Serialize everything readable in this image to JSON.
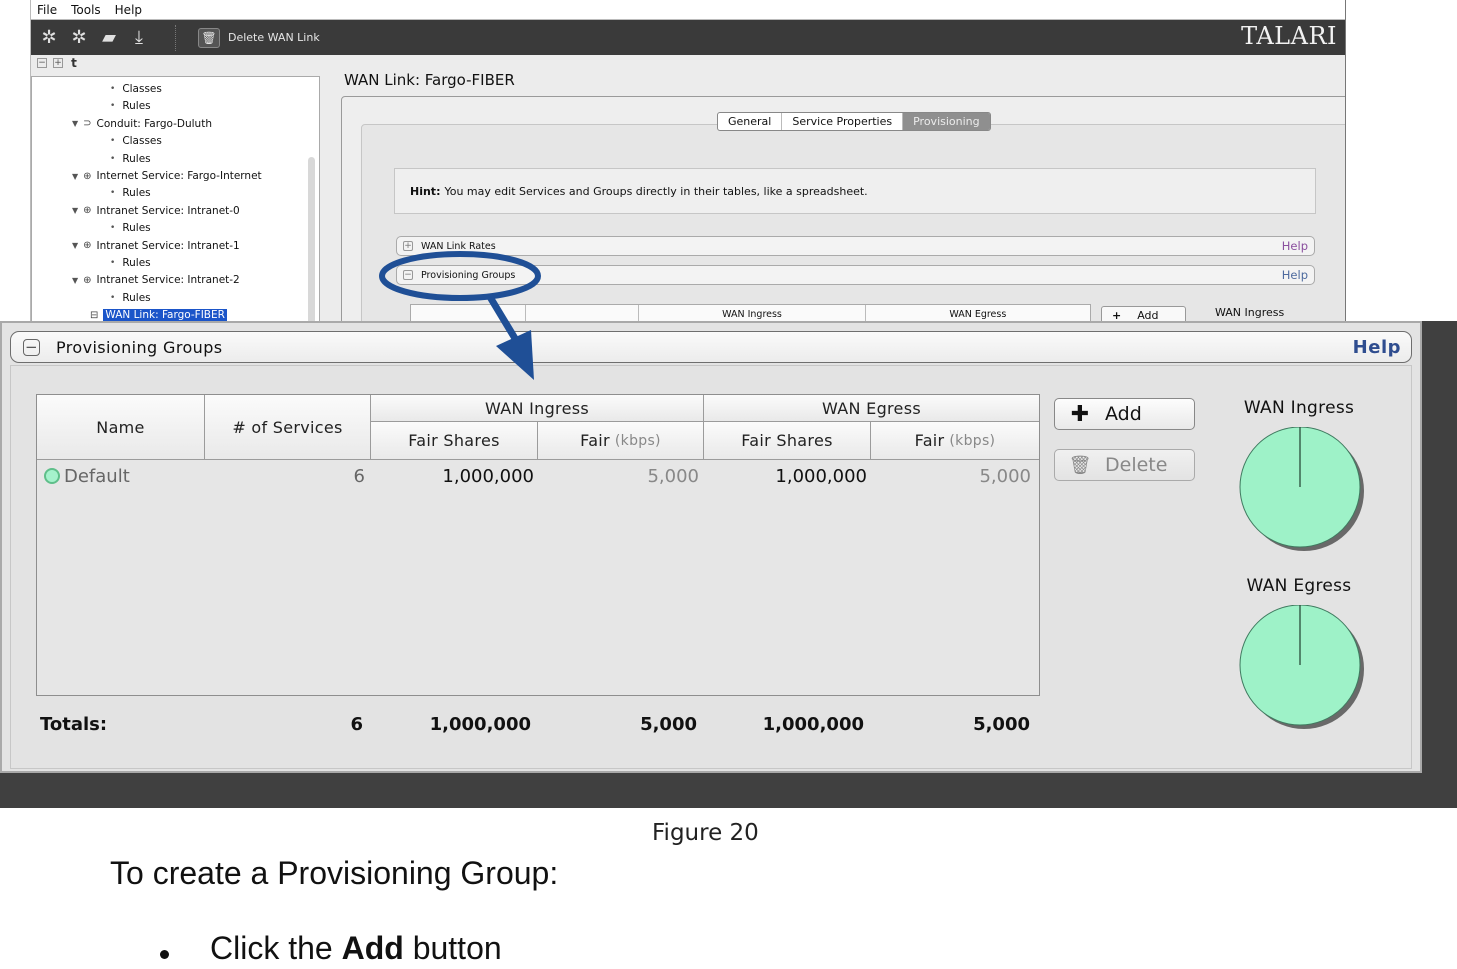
{
  "menu": [
    "File",
    "Tools",
    "Help"
  ],
  "toolbar": {
    "icons": [
      "gear-back-icon",
      "gear-forward-icon",
      "folder-icon",
      "download-icon"
    ],
    "delete_label": "Delete WAN Link",
    "brand": "TALARI"
  },
  "tree": {
    "items": [
      {
        "type": "leaf",
        "label": "Classes"
      },
      {
        "type": "leaf",
        "label": "Rules"
      },
      {
        "type": "node",
        "icon": "conduit-icon",
        "label": "Conduit: Fargo-Duluth"
      },
      {
        "type": "leaf",
        "label": "Classes"
      },
      {
        "type": "leaf",
        "label": "Rules"
      },
      {
        "type": "node",
        "icon": "globe-icon",
        "label": "Internet Service: Fargo-Internet"
      },
      {
        "type": "leaf",
        "label": "Rules"
      },
      {
        "type": "node",
        "icon": "globe-icon",
        "label": "Intranet Service: Intranet-0"
      },
      {
        "type": "leaf",
        "label": "Rules"
      },
      {
        "type": "node",
        "icon": "globe-icon",
        "label": "Intranet Service: Intranet-1"
      },
      {
        "type": "leaf",
        "label": "Rules"
      },
      {
        "type": "node",
        "icon": "globe-icon",
        "label": "Intranet Service: Intranet-2"
      },
      {
        "type": "leaf",
        "label": "Rules"
      },
      {
        "type": "selected",
        "icon": "wan-link-icon",
        "label": "WAN Link: Fargo-FIBER"
      }
    ]
  },
  "page": {
    "title": "WAN Link: Fargo-FIBER",
    "tabs": [
      {
        "label": "General",
        "active": false
      },
      {
        "label": "Service Properties",
        "active": false
      },
      {
        "label": "Provisioning",
        "active": true
      }
    ],
    "hint_bold": "Hint:",
    "hint_text": "You may edit Services and Groups directly in their tables, like a spreadsheet.",
    "sections": [
      {
        "label": "WAN Link Rates",
        "expanded": false,
        "help": "Help",
        "help_color": "#8a4f9e"
      },
      {
        "label": "Provisioning Groups",
        "expanded": true,
        "help": "Help",
        "help_color": "#4d6a9e"
      }
    ],
    "mini_table": {
      "ingress": "WAN Ingress",
      "egress": "WAN Egress"
    },
    "mini_add": "Add",
    "mini_pie_label": "WAN Ingress"
  },
  "callout_color": "#1f4f96",
  "provisioning_groups": {
    "title": "Provisioning Groups",
    "help": "Help",
    "columns": {
      "name": "Name",
      "services": "# of Services",
      "ingress_group": "WAN Ingress",
      "egress_group": "WAN Egress",
      "fair_shares": "Fair Shares",
      "fair": "Fair",
      "kbps": "(kbps)"
    },
    "rows": [
      {
        "name": "Default",
        "services": "6",
        "ingress_shares": "1,000,000",
        "ingress_kbps": "5,000",
        "egress_shares": "1,000,000",
        "egress_kbps": "5,000"
      }
    ],
    "totals": {
      "label": "Totals:",
      "services": "6",
      "ingress_shares": "1,000,000",
      "ingress_kbps": "5,000",
      "egress_shares": "1,000,000",
      "egress_kbps": "5,000"
    },
    "add_label": "Add",
    "delete_label": "Delete",
    "pies": [
      {
        "title": "WAN Ingress",
        "slices": [
          {
            "name": "Default",
            "percent": 100,
            "color": "#9ef2c8"
          }
        ]
      },
      {
        "title": "WAN Egress",
        "slices": [
          {
            "name": "Default",
            "percent": 100,
            "color": "#9ef2c8"
          }
        ]
      }
    ]
  },
  "document": {
    "caption": "Figure 20",
    "heading": "To create a Provisioning Group:",
    "bullet_prefix": "Click the ",
    "bullet_bold": "Add",
    "bullet_suffix": " button"
  }
}
